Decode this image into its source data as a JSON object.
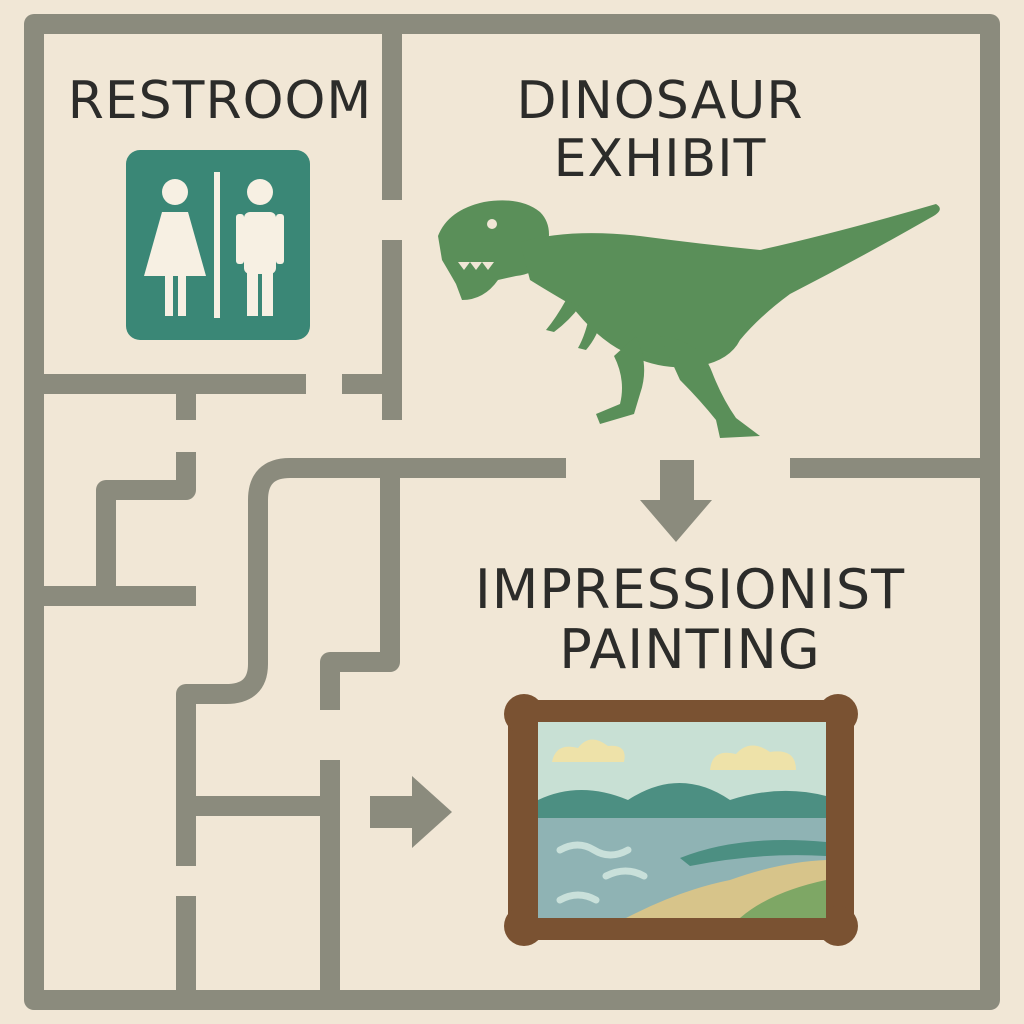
{
  "colors": {
    "background": "#f1e7d6",
    "wall": "#8b8b7d",
    "text": "#2c2c2a",
    "restroom_sign": "#3a8776",
    "restroom_icon": "#f7f0e3",
    "dinosaur": "#5a8f59",
    "frame": "#7a5232",
    "sky": "#c8e0d4",
    "cloud": "#eee2a9",
    "hill": "#4c8f82",
    "water": "#8fb3b4",
    "wave": "#c9e0da",
    "sand": "#d7c48a",
    "grass": "#7ea765",
    "arrow": "#8b8b7d"
  },
  "rooms": {
    "restroom": {
      "label": "RESTROOM",
      "icon": "restroom-sign-icon"
    },
    "dinosaur_exhibit": {
      "label_line1": "DINOSAUR",
      "label_line2": "EXHIBIT",
      "icon": "dinosaur-icon"
    },
    "impressionist_painting": {
      "label_line1": "IMPRESSIONIST",
      "label_line2": "PAINTING",
      "icon": "painting-icon"
    }
  },
  "arrows": [
    {
      "icon": "arrow-down-icon",
      "direction": "down"
    },
    {
      "icon": "arrow-right-icon",
      "direction": "right"
    }
  ]
}
